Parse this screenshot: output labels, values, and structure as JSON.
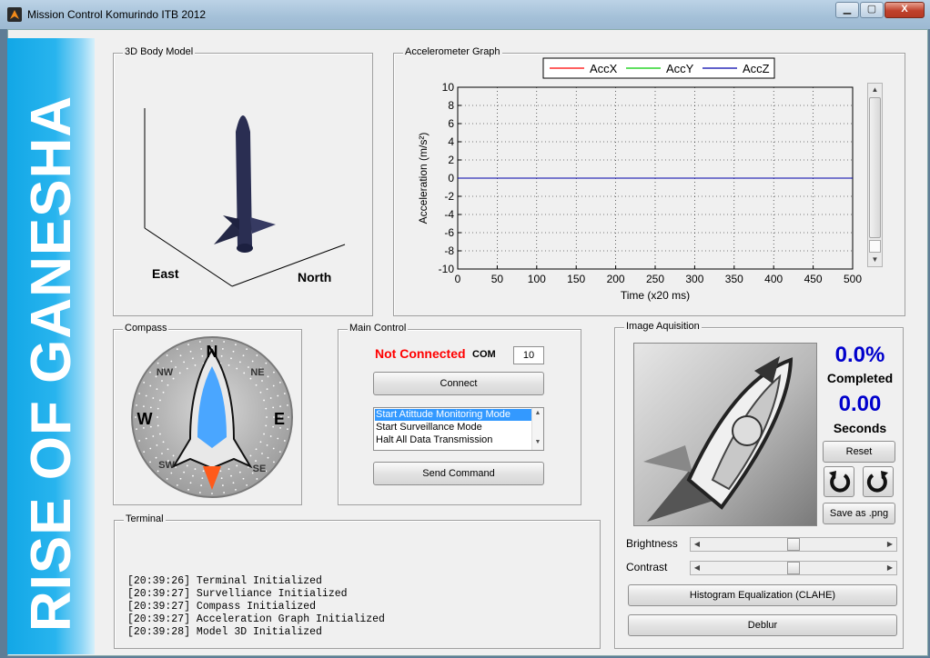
{
  "window": {
    "title": "Mission Control Komurindo ITB 2012",
    "min": "▁",
    "max": "▢",
    "close": "X"
  },
  "banner": {
    "text": "RISE OF GANESHA"
  },
  "body_model": {
    "title": "3D Body Model",
    "label_east": "East",
    "label_north": "North"
  },
  "accel": {
    "title": "Accelerometer Graph"
  },
  "chart_data": {
    "type": "line",
    "xlabel": "Time (x20 ms)",
    "ylabel": "Acceleration (m/s²)",
    "xlim": [
      0,
      500
    ],
    "ylim": [
      -10,
      10
    ],
    "x_ticks": [
      0,
      50,
      100,
      150,
      200,
      250,
      300,
      350,
      400,
      450,
      500
    ],
    "y_ticks": [
      10,
      8,
      6,
      4,
      2,
      0,
      -2,
      -4,
      -6,
      -8,
      -10
    ],
    "grid": true,
    "legend_placement": "top-center",
    "series": [
      {
        "name": "AccX",
        "color": "#ff0000",
        "x": [
          0,
          500
        ],
        "y": [
          0,
          0
        ]
      },
      {
        "name": "AccY",
        "color": "#00cc00",
        "x": [
          0,
          500
        ],
        "y": [
          0,
          0
        ]
      },
      {
        "name": "AccZ",
        "color": "#0000aa",
        "x": [
          0,
          500
        ],
        "y": [
          0,
          0
        ]
      }
    ]
  },
  "compass": {
    "title": "Compass",
    "N": "N",
    "NE": "NE",
    "E": "E",
    "SE": "SE",
    "S": "S",
    "SW": "SW",
    "W": "W",
    "NW": "NW"
  },
  "main_control": {
    "title": "Main Control",
    "status": "Not Connected",
    "status_color": "#ff0000",
    "com_label": "COM",
    "com_value": "10",
    "connect_label": "Connect",
    "modes": [
      "Start Atittude Monitoring Mode",
      "Start Surveillance Mode",
      "Halt All Data Transmission"
    ],
    "selected_mode": "Start Atittude Monitoring Mode",
    "send_label": "Send Command"
  },
  "terminal": {
    "title": "Terminal",
    "lines": [
      "[20:39:26] Terminal Initialized",
      "[20:39:27] Survelliance Initialized",
      "[20:39:27] Compass Initialized",
      "[20:39:27] Acceleration Graph Initialized",
      "[20:39:28] Model 3D Initialized"
    ]
  },
  "image_acq": {
    "title": "Image Aquisition",
    "percent": "0.0%",
    "completed_label": "Completed",
    "seconds": "0.00",
    "seconds_label": "Seconds",
    "reset_label": "Reset",
    "save_label": "Save as .png",
    "brightness_label": "Brightness",
    "brightness_value": 0.5,
    "contrast_label": "Contrast",
    "contrast_value": 0.5,
    "clahe_label": "Histogram Equalization (CLAHE)",
    "deblur_label": "Deblur",
    "accent_color": "#0000cc"
  }
}
